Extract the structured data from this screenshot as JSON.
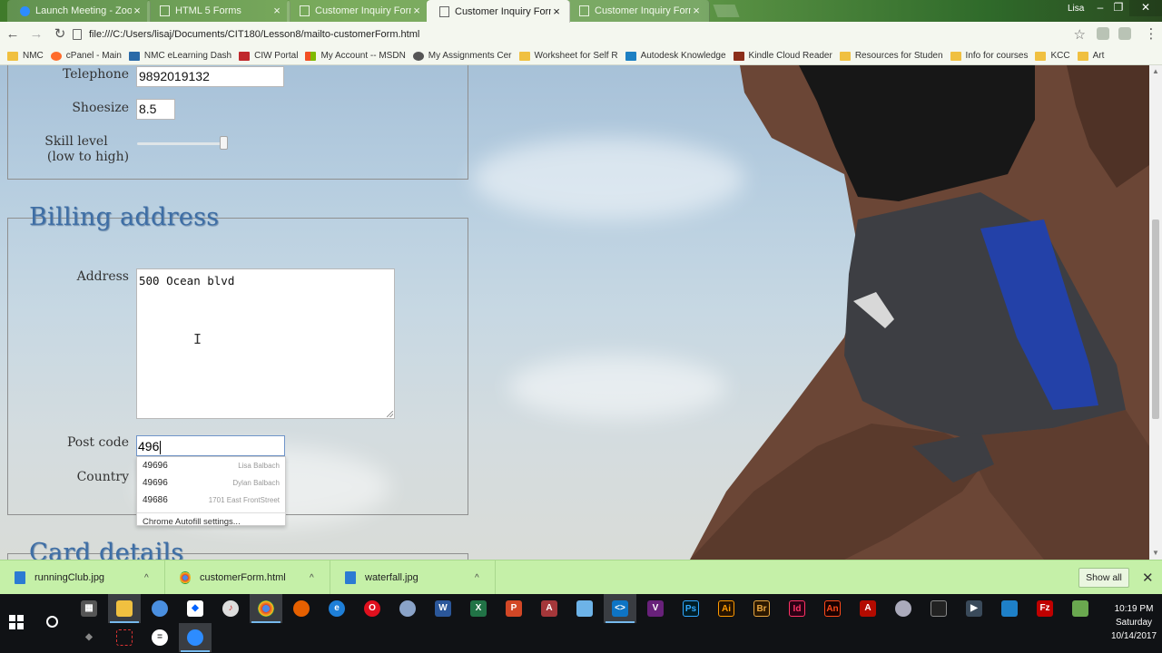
{
  "browser": {
    "tabs": [
      {
        "title": "Launch Meeting - Zoom",
        "active": false
      },
      {
        "title": "HTML 5 Forms",
        "active": false
      },
      {
        "title": "Customer Inquiry Form",
        "active": false
      },
      {
        "title": "Customer Inquiry Form",
        "active": true
      },
      {
        "title": "Customer Inquiry Form",
        "active": false
      }
    ],
    "profile_name": "Lisa",
    "url": "file:///C:/Users/lisaj/Documents/CIT180/Lesson8/mailto-customerForm.html",
    "bookmarks": [
      {
        "label": "NMC",
        "icon": "folder-icon"
      },
      {
        "label": "cPanel - Main",
        "icon": "cpanel-icon"
      },
      {
        "label": "NMC eLearning Dash",
        "icon": "nmc-icon"
      },
      {
        "label": "CIW Portal",
        "icon": "ciw-icon"
      },
      {
        "label": "My Account -- MSDN",
        "icon": "windows-icon"
      },
      {
        "label": "My Assignments Cer",
        "icon": "globe-icon"
      },
      {
        "label": "Worksheet for Self R",
        "icon": "folder-icon"
      },
      {
        "label": "Autodesk Knowledge",
        "icon": "autodesk-icon"
      },
      {
        "label": "Kindle Cloud Reader",
        "icon": "kindle-icon"
      },
      {
        "label": "Resources for Studen",
        "icon": "folder-icon"
      },
      {
        "label": "Info for courses",
        "icon": "folder-icon"
      },
      {
        "label": "KCC",
        "icon": "folder-icon"
      },
      {
        "label": "Art",
        "icon": "folder-icon"
      }
    ]
  },
  "form": {
    "telephone": {
      "label": "Telephone",
      "value": "9892019132"
    },
    "shoesize": {
      "label": "Shoesize",
      "value": "8.5"
    },
    "skill": {
      "label_line1": "Skill level",
      "label_line2": "(low to high)",
      "level_fraction": 1.0
    },
    "billing": {
      "legend": "Billing address",
      "address_label": "Address",
      "address_value": "500 Ocean blvd",
      "postcode_label": "Post code",
      "postcode_value": "496",
      "country_label": "Country"
    },
    "autofill": {
      "suggestions": [
        {
          "value": "49696",
          "name": "Lisa Balbach"
        },
        {
          "value": "49696",
          "name": "Dylan Balbach"
        },
        {
          "value": "49686",
          "name": "1701 East FrontStreet"
        }
      ],
      "settings_label": "Chrome Autofill settings..."
    },
    "card_legend": "Card details"
  },
  "downloads": {
    "items": [
      {
        "name": "runningClub.jpg",
        "icon": "image-file-icon"
      },
      {
        "name": "customerForm.html",
        "icon": "chrome-file-icon"
      },
      {
        "name": "waterfall.jpg",
        "icon": "image-file-icon"
      }
    ],
    "show_all": "Show all"
  },
  "taskbar": {
    "time": "10:19 PM",
    "day": "Saturday",
    "date": "10/14/2017"
  }
}
